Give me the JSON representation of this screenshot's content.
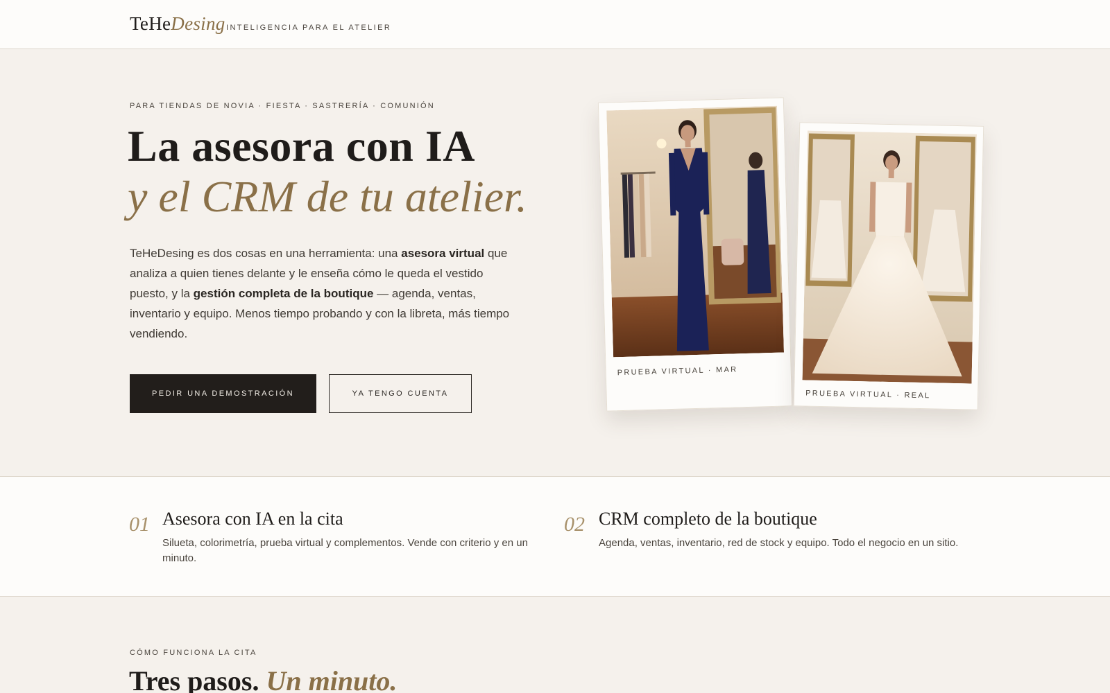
{
  "header": {
    "logo_main": "TeHe",
    "logo_accent": "Desing",
    "tagline": "INTELIGENCIA PARA EL ATELIER"
  },
  "hero": {
    "eyebrow": "PARA TIENDAS DE NOVIA · FIESTA · SASTRERÍA · COMUNIÓN",
    "headline_line1": "La asesora con IA",
    "headline_line2": "y el CRM de tu atelier.",
    "lead": {
      "p1": "TeHeDesing es dos cosas en una herramienta: una ",
      "b1": "asesora virtual",
      "p2": " que analiza a quien tienes delante y le enseña cómo le queda el vestido puesto, y la ",
      "b2": "gestión completa de la boutique",
      "p3": " — agenda, ventas, inventario y equipo. Menos tiempo probando y con la libreta, más tiempo vendiendo."
    },
    "primary_cta": "PEDIR UNA DEMOSTRACIÓN",
    "secondary_cta": "YA TENGO CUENTA",
    "cards": [
      {
        "caption": "PRUEBA VIRTUAL · MAR",
        "image": "navy-dress-photo"
      },
      {
        "caption": "PRUEBA VIRTUAL · REAL",
        "image": "bridal-gown-photo"
      }
    ]
  },
  "features": [
    {
      "num": "01",
      "title": "Asesora con IA en la cita",
      "desc": "Silueta, colorimetría, prueba virtual y complementos. Vende con criterio y en un minuto."
    },
    {
      "num": "02",
      "title": "CRM completo de la boutique",
      "desc": "Agenda, ventas, inventario, red de stock y equipo. Todo el negocio en un sitio."
    }
  ],
  "how": {
    "eyebrow": "CÓMO FUNCIONA LA CITA",
    "title_main": "Tres pasos.",
    "title_accent": "Un minuto."
  },
  "colors": {
    "background": "#f5f1ec",
    "surface": "#fdfcfa",
    "ink": "#1f1c1a",
    "accent_gold": "#8a7048",
    "button_dark": "#221e1b"
  }
}
